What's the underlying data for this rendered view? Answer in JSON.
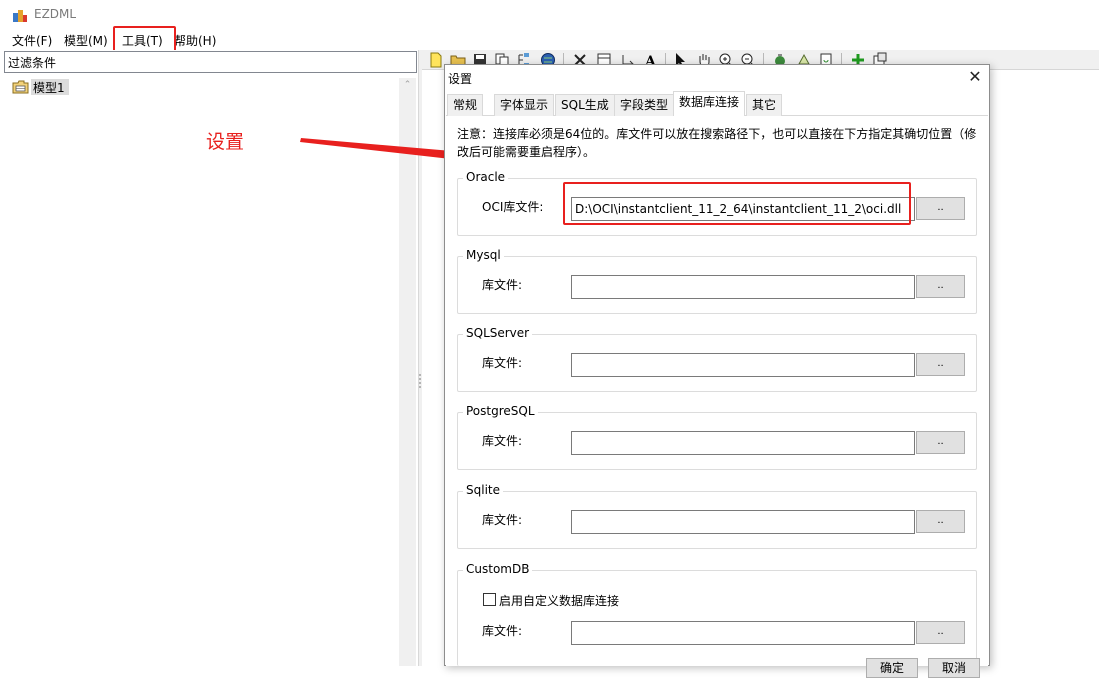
{
  "window": {
    "title": "EZDML"
  },
  "menu": {
    "file": "文件(F)",
    "model": "模型(M)",
    "tools": "工具(T)",
    "help": "帮助(H)"
  },
  "left_panel": {
    "filter_label": "过滤条件",
    "tree_items": [
      "模型1"
    ]
  },
  "annotation": {
    "text": "设置",
    "color": "#e8201e"
  },
  "toolbar_icons": [
    "new-icon",
    "open-icon",
    "save-icon",
    "copy-icon",
    "tree-icon",
    "globe-icon",
    "delete-icon",
    "table-icon",
    "link-icon",
    "text-icon",
    "pointer-icon",
    "hand-icon",
    "zoom-in-icon",
    "zoom-out-icon",
    "export-icon",
    "recycle-icon",
    "refresh-icon",
    "add-icon",
    "settings-icon"
  ],
  "dialog": {
    "title": "设置",
    "close": "✕",
    "tabs": [
      "常规",
      "字体显示",
      "SQL生成",
      "字段类型",
      "数据库连接",
      "其它"
    ],
    "active_tab": "数据库连接",
    "note": "注意：连接库必须是64位的。库文件可以放在搜索路径下，也可以直接在下方指定其确切位置（修改后可能需要重启程序）。",
    "groups": {
      "oracle": {
        "label": "Oracle",
        "field_label": "OCI库文件:",
        "value": "D:\\OCI\\instantclient_11_2_64\\instantclient_11_2\\oci.dll"
      },
      "mysql": {
        "label": "Mysql",
        "field_label": "库文件:",
        "value": ""
      },
      "sqlserver": {
        "label": "SQLServer",
        "field_label": "库文件:",
        "value": ""
      },
      "postgresql": {
        "label": "PostgreSQL",
        "field_label": "库文件:",
        "value": ""
      },
      "sqlite": {
        "label": "Sqlite",
        "field_label": "库文件:",
        "value": ""
      },
      "customdb": {
        "label": "CustomDB",
        "checkbox_label": "启用自定义数据库连接",
        "checked": false,
        "field_label": "库文件:",
        "value": ""
      }
    },
    "browse_label": "..",
    "ok": "确定",
    "cancel": "取消"
  }
}
